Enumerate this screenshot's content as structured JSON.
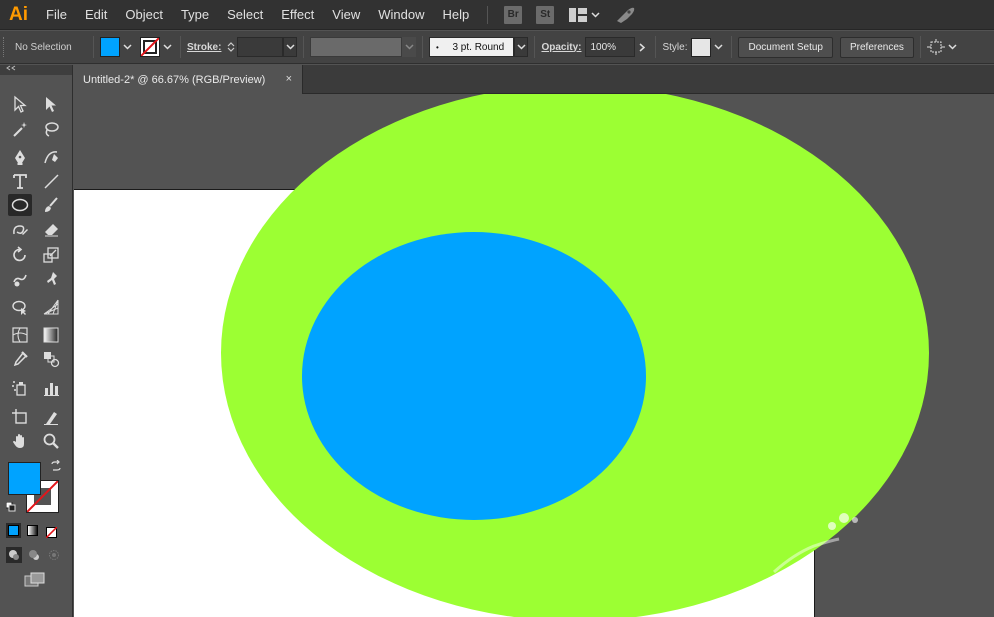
{
  "app": {
    "logo_text": "Ai",
    "logo_color": "#ff9a00"
  },
  "menu": {
    "items": [
      "File",
      "Edit",
      "Object",
      "Type",
      "Select",
      "Effect",
      "View",
      "Window",
      "Help"
    ],
    "bridge_label": "Br",
    "stock_label": "St"
  },
  "control_bar": {
    "selection_status": "No Selection",
    "fill_color": "#00a3ff",
    "stroke_label": "Stroke:",
    "stroke_weight": "",
    "brush_label": "3 pt. Round",
    "opacity_label": "Opacity:",
    "opacity_value": "100%",
    "style_label": "Style:",
    "document_setup_label": "Document Setup",
    "preferences_label": "Preferences"
  },
  "document": {
    "tab_title": "Untitled-2* @ 66.67% (RGB/Preview)",
    "close_glyph": "×"
  },
  "artwork": {
    "outer_ellipse_color": "#9cff33",
    "inner_ellipse_color": "#00a3ff",
    "artboard_color": "#ffffff"
  },
  "toolbar": {
    "fill_swatch_color": "#00a3ff",
    "tools": [
      "selection-tool",
      "direct-selection-tool",
      "magic-wand-tool",
      "lasso-tool",
      "pen-tool",
      "curvature-tool",
      "type-tool",
      "line-segment-tool",
      "ellipse-tool",
      "paintbrush-tool",
      "shaper-tool",
      "eraser-tool",
      "rotate-tool",
      "scale-tool",
      "warp-tool",
      "puppet-warp-tool",
      "shape-builder-tool",
      "perspective-grid-tool",
      "mesh-tool",
      "gradient-tool",
      "eyedropper-tool",
      "blend-tool",
      "symbol-sprayer-tool",
      "column-graph-tool",
      "artboard-tool",
      "slice-tool",
      "hand-tool",
      "zoom-tool"
    ],
    "active_tool": "ellipse-tool"
  }
}
